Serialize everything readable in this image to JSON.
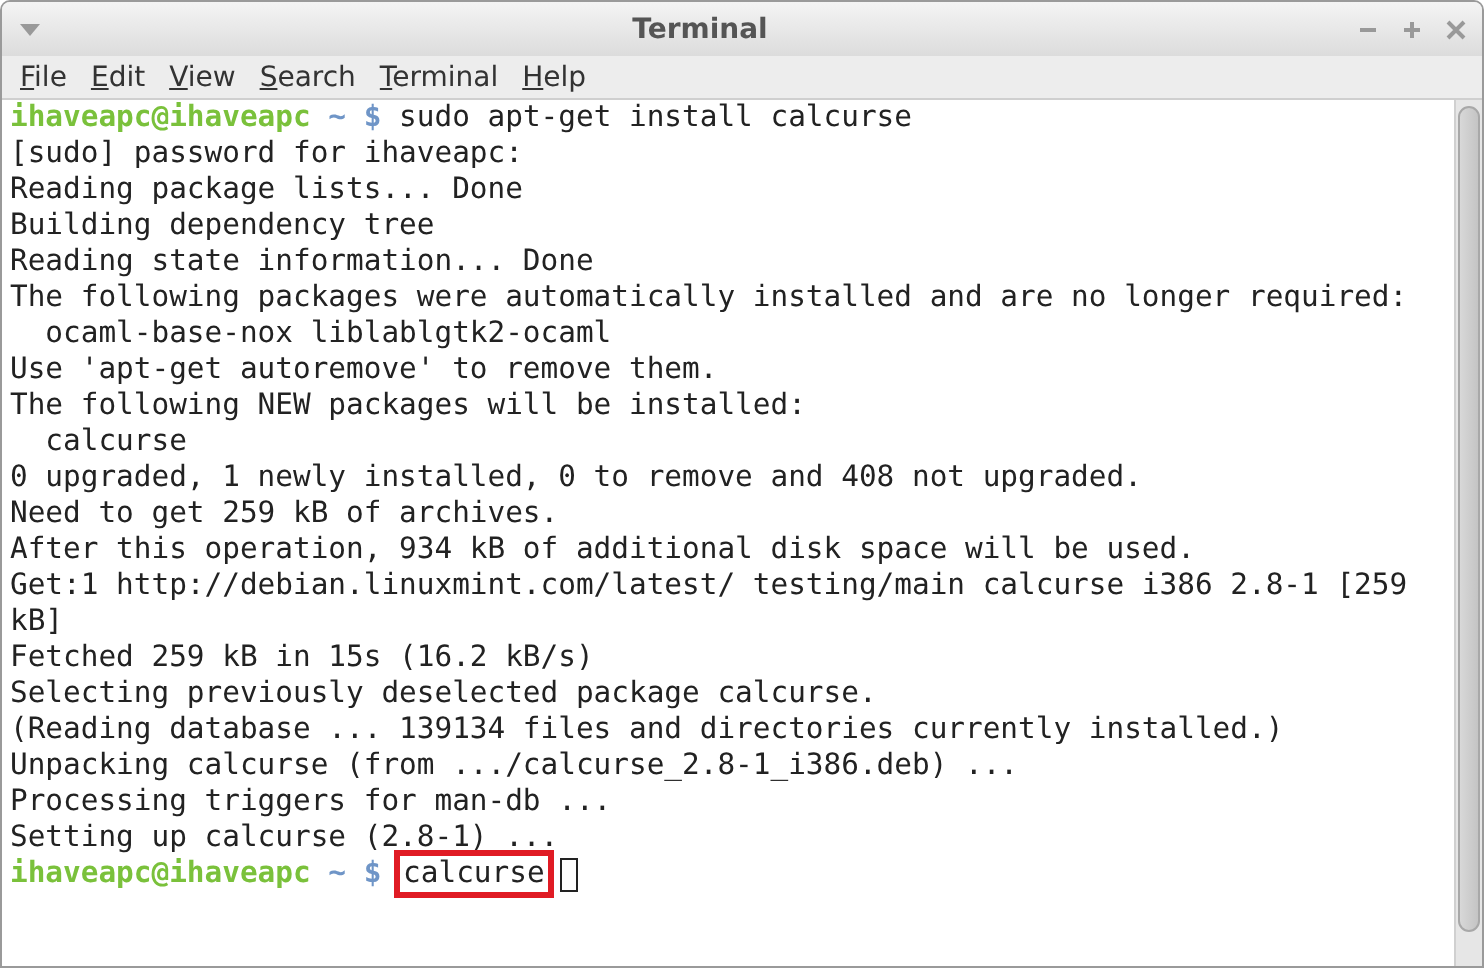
{
  "window": {
    "title": "Terminal"
  },
  "menu": [
    {
      "label": "File"
    },
    {
      "label": "Edit"
    },
    {
      "label": "View"
    },
    {
      "label": "Search"
    },
    {
      "label": "Terminal"
    },
    {
      "label": "Help"
    }
  ],
  "terminal": {
    "lines": [
      {
        "kind": "prompt",
        "user": "ihaveapc@ihaveapc",
        "path": "~",
        "symbol": "$",
        "command": "sudo apt-get install calcurse",
        "highlighted": false,
        "cursor": false
      },
      {
        "kind": "output",
        "text": "[sudo] password for ihaveapc:"
      },
      {
        "kind": "output",
        "text": "Reading package lists... Done"
      },
      {
        "kind": "output",
        "text": "Building dependency tree"
      },
      {
        "kind": "output",
        "text": "Reading state information... Done"
      },
      {
        "kind": "output",
        "text": "The following packages were automatically installed and are no longer required:"
      },
      {
        "kind": "output",
        "text": "  ocaml-base-nox liblablgtk2-ocaml"
      },
      {
        "kind": "output",
        "text": "Use 'apt-get autoremove' to remove them."
      },
      {
        "kind": "output",
        "text": "The following NEW packages will be installed:"
      },
      {
        "kind": "output",
        "text": "  calcurse"
      },
      {
        "kind": "output",
        "text": "0 upgraded, 1 newly installed, 0 to remove and 408 not upgraded."
      },
      {
        "kind": "output",
        "text": "Need to get 259 kB of archives."
      },
      {
        "kind": "output",
        "text": "After this operation, 934 kB of additional disk space will be used."
      },
      {
        "kind": "output",
        "text": "Get:1 http://debian.linuxmint.com/latest/ testing/main calcurse i386 2.8-1 [259"
      },
      {
        "kind": "output",
        "text": "kB]"
      },
      {
        "kind": "output",
        "text": "Fetched 259 kB in 15s (16.2 kB/s)"
      },
      {
        "kind": "output",
        "text": "Selecting previously deselected package calcurse."
      },
      {
        "kind": "output",
        "text": "(Reading database ... 139134 files and directories currently installed.)"
      },
      {
        "kind": "output",
        "text": "Unpacking calcurse (from .../calcurse_2.8-1_i386.deb) ..."
      },
      {
        "kind": "output",
        "text": "Processing triggers for man-db ..."
      },
      {
        "kind": "output",
        "text": "Setting up calcurse (2.8-1) ..."
      },
      {
        "kind": "prompt",
        "user": "ihaveapc@ihaveapc",
        "path": "~",
        "symbol": "$",
        "command": "calcurse",
        "highlighted": true,
        "cursor": true
      }
    ]
  }
}
